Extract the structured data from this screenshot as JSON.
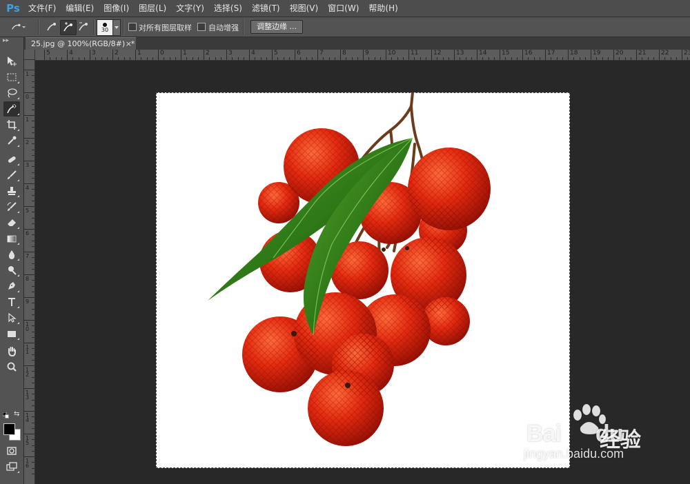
{
  "app": {
    "logo": "Ps"
  },
  "menu": [
    "文件(F)",
    "编辑(E)",
    "图像(I)",
    "图层(L)",
    "文字(Y)",
    "选择(S)",
    "滤镜(T)",
    "视图(V)",
    "窗口(W)",
    "帮助(H)"
  ],
  "options": {
    "brush_size": "30",
    "sample_all_layers_label": "对所有图层取样",
    "sample_all_layers_checked": false,
    "auto_enhance_label": "自动增强",
    "auto_enhance_checked": false,
    "refine_edge_label": "调整边缘 ..."
  },
  "document_tab": {
    "title": "25.jpg @ 100%(RGB/8#)",
    "modified_marker": "*",
    "close_glyph": "×"
  },
  "ruler_top_labels": [
    "5",
    "4",
    "3",
    "2",
    "1",
    "0",
    "1",
    "2",
    "3",
    "4",
    "5",
    "6",
    "7",
    "8",
    "9",
    "10",
    "11",
    "12",
    "13",
    "14",
    "15",
    "16",
    "17",
    "18",
    "19",
    "20",
    "21",
    "22",
    "23"
  ],
  "ruler_left_labels": [
    "1",
    "0",
    "1",
    "2",
    "3",
    "4",
    "5",
    "6",
    "7",
    "8",
    "9",
    "10",
    "11",
    "12",
    "13",
    "14",
    "15",
    "16"
  ],
  "toolbar": [
    "move-tool",
    "rectangular-marquee-tool",
    "lasso-tool",
    "quick-selection-tool",
    "crop-tool",
    "eyedropper-tool",
    "spot-healing-brush-tool",
    "brush-tool",
    "clone-stamp-tool",
    "history-brush-tool",
    "eraser-tool",
    "gradient-tool",
    "blur-tool",
    "dodge-tool",
    "pen-tool",
    "type-tool",
    "path-selection-tool",
    "rectangle-tool",
    "hand-tool",
    "zoom-tool"
  ],
  "colors": {
    "foreground": "#000000",
    "background": "#ffffff",
    "lychee": "#d9260f",
    "leaf": "#2e7d1a"
  },
  "watermark": {
    "brand": "Bai",
    "brand2": "du",
    "product": "经验",
    "url": "jingyan.baidu.com"
  }
}
